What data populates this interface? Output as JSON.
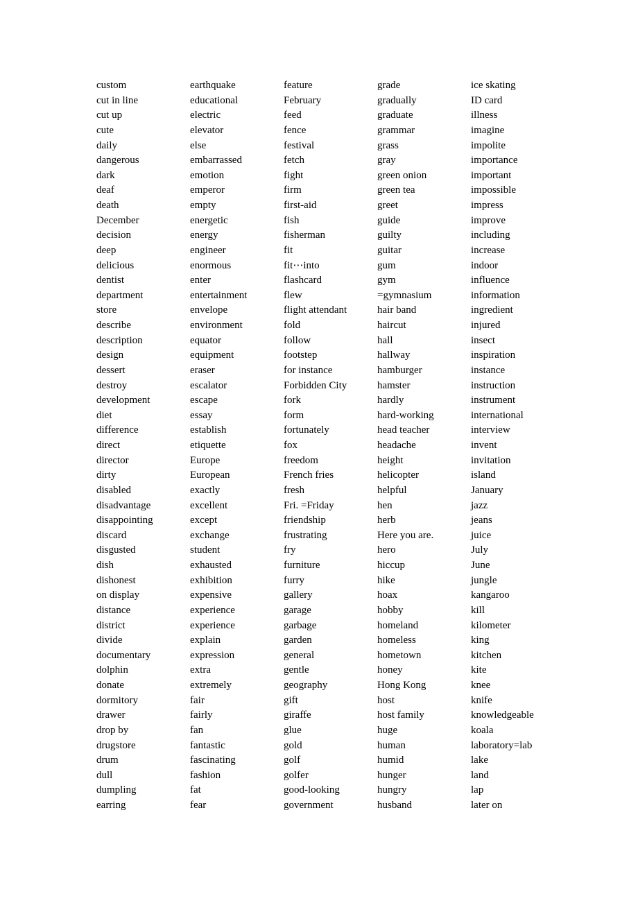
{
  "document": {
    "type": "vocabulary-list",
    "columns": [
      {
        "words": [
          "custom",
          "cut in line",
          "cut up",
          "cute",
          "daily",
          "dangerous",
          "dark",
          "deaf",
          "death",
          "December",
          "decision",
          "deep",
          "delicious",
          "dentist",
          "department",
          "store",
          "describe",
          "description",
          "design",
          "dessert",
          "destroy",
          "development",
          "diet",
          "difference",
          "direct",
          "director",
          "dirty",
          "disabled",
          "disadvantage",
          "disappointing",
          "discard",
          "disgusted",
          "dish",
          "dishonest",
          "on display",
          "distance",
          "district",
          "divide",
          "documentary",
          "dolphin",
          "donate",
          "dormitory",
          "drawer",
          "drop by",
          "drugstore",
          "drum",
          "dull",
          "dumpling",
          "earring"
        ]
      },
      {
        "words": [
          "earthquake",
          "educational",
          "electric",
          "elevator",
          "else",
          "embarrassed",
          "emotion",
          "emperor",
          "empty",
          "energetic",
          "energy",
          "engineer",
          "enormous",
          "enter",
          "entertainment",
          "envelope",
          "environment",
          "equator",
          "equipment",
          "eraser",
          "escalator",
          "escape",
          "essay",
          "establish",
          "etiquette",
          "Europe",
          "European",
          "exactly",
          "excellent",
          "except",
          "exchange",
          "student",
          "exhausted",
          "exhibition",
          "expensive",
          "experience",
          "experience",
          "explain",
          "expression",
          "extra",
          "extremely",
          "fair",
          "fairly",
          "fan",
          "fantastic",
          "fascinating",
          "fashion",
          "fat",
          "fear"
        ]
      },
      {
        "words": [
          "feature",
          "February",
          "feed",
          "fence",
          "festival",
          "fetch",
          "fight",
          "firm",
          "first-aid",
          "fish",
          "fisherman",
          "fit",
          "fit⋯into",
          "flashcard",
          "flew",
          "flight attendant",
          "fold",
          "follow",
          "footstep",
          "for instance",
          "Forbidden City",
          "fork",
          "form",
          "fortunately",
          "fox",
          "freedom",
          "French fries",
          "fresh",
          "Fri. =Friday",
          "friendship",
          "frustrating",
          "fry",
          "furniture",
          "furry",
          "gallery",
          "garage",
          "garbage",
          "garden",
          "general",
          "gentle",
          "geography",
          "gift",
          "giraffe",
          "glue",
          "gold",
          "golf",
          "golfer",
          "good-looking",
          "government"
        ]
      },
      {
        "words": [
          "grade",
          "gradually",
          "graduate",
          "grammar",
          "grass",
          "gray",
          "green onion",
          "green tea",
          "greet",
          "guide",
          "guilty",
          "guitar",
          "gum",
          "gym",
          "=gymnasium",
          "hair band",
          "haircut",
          "hall",
          "hallway",
          "hamburger",
          "hamster",
          "hardly",
          "hard-working",
          "head teacher",
          "headache",
          "height",
          "helicopter",
          "helpful",
          "hen",
          "herb",
          "Here you are.",
          "hero",
          "hiccup",
          "hike",
          "hoax",
          "hobby",
          "homeland",
          "homeless",
          "hometown",
          "honey",
          "Hong Kong",
          "host",
          "host family",
          "huge",
          "human",
          "humid",
          "hunger",
          "hungry",
          "husband"
        ]
      },
      {
        "words": [
          "ice skating",
          "ID card",
          "illness",
          "imagine",
          "impolite",
          "importance",
          "important",
          "impossible",
          "impress",
          "improve",
          "including",
          "increase",
          "indoor",
          "influence",
          "information",
          "ingredient",
          "injured",
          "insect",
          "inspiration",
          "instance",
          "instruction",
          "instrument",
          "international",
          "interview",
          "invent",
          "invitation",
          "island",
          "January",
          "jazz",
          "jeans",
          "juice",
          "July",
          "June",
          "jungle",
          "kangaroo",
          "kill",
          "kilometer",
          "king",
          "kitchen",
          "kite",
          "knee",
          "knife",
          "knowledgeable",
          "koala",
          "laboratory=lab",
          "lake",
          "land",
          "lap",
          "later on"
        ]
      }
    ]
  }
}
